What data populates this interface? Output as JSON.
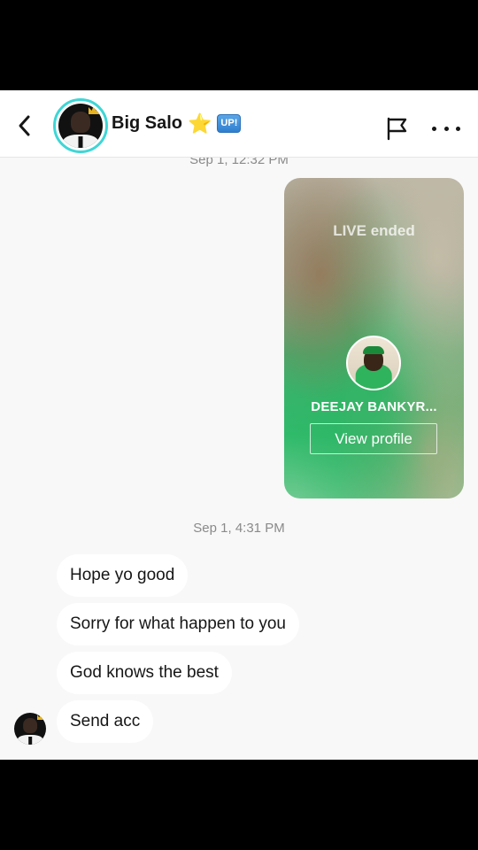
{
  "header": {
    "title": "Big Salo",
    "star_emoji": "⭐",
    "badge": "UP!",
    "back_icon": "chevron-left-icon",
    "flag_icon": "flag-icon",
    "more_icon": "more-horizontal-icon"
  },
  "previous_timestamp": "Sep 1, 12:32 PM",
  "live_card": {
    "status": "LIVE ended",
    "host_name": "DEEJAY BANKYR...",
    "button_label": "View profile"
  },
  "timestamp": "Sep 1, 4:31 PM",
  "messages": [
    {
      "text": "Hope yo good"
    },
    {
      "text": "Sorry for what happen to you"
    },
    {
      "text": "God knows the best"
    },
    {
      "text": "Send acc"
    }
  ],
  "colors": {
    "avatar_ring": "#3fd6d6",
    "badge": "#2f7fd0",
    "live_green": "#2fba6a"
  }
}
